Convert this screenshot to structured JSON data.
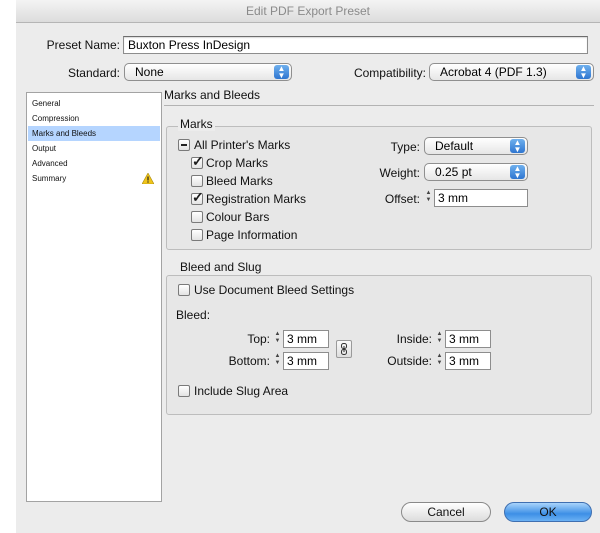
{
  "window": {
    "title": "Edit PDF Export Preset"
  },
  "preset": {
    "label": "Preset Name:",
    "value": "Buxton Press InDesign"
  },
  "standard": {
    "label": "Standard:",
    "value": "None"
  },
  "compatibility": {
    "label": "Compatibility:",
    "value": "Acrobat 4 (PDF 1.3)"
  },
  "sidebar": {
    "items": [
      {
        "label": "General"
      },
      {
        "label": "Compression"
      },
      {
        "label": "Marks and Bleeds"
      },
      {
        "label": "Output"
      },
      {
        "label": "Advanced"
      },
      {
        "label": "Summary"
      }
    ],
    "selected": "Marks and Bleeds",
    "warning_icon": "warning-icon"
  },
  "panel": {
    "title": "Marks and Bleeds"
  },
  "marks": {
    "group_title": "Marks",
    "all": {
      "label": "All Printer's Marks",
      "state": "mixed"
    },
    "crop": {
      "label": "Crop Marks",
      "checked": true
    },
    "bleed": {
      "label": "Bleed Marks",
      "checked": false
    },
    "registration": {
      "label": "Registration Marks",
      "checked": true
    },
    "colour_bars": {
      "label": "Colour Bars",
      "checked": false
    },
    "page_info": {
      "label": "Page Information",
      "checked": false
    },
    "type": {
      "label": "Type:",
      "value": "Default"
    },
    "weight": {
      "label": "Weight:",
      "value": "0.25 pt"
    },
    "offset": {
      "label": "Offset:",
      "value": "3 mm"
    }
  },
  "bleed_slug": {
    "group_title": "Bleed and Slug",
    "use_document": {
      "label": "Use Document Bleed Settings",
      "checked": false
    },
    "bleed_label": "Bleed:",
    "top": {
      "label": "Top:",
      "value": "3 mm"
    },
    "bottom": {
      "label": "Bottom:",
      "value": "3 mm"
    },
    "inside": {
      "label": "Inside:",
      "value": "3 mm"
    },
    "outside": {
      "label": "Outside:",
      "value": "3 mm"
    },
    "include_slug": {
      "label": "Include Slug Area",
      "checked": false
    }
  },
  "buttons": {
    "cancel": "Cancel",
    "ok": "OK"
  },
  "colors": {
    "selection": "#b5d5ff",
    "aqua_blue": "#3d8fe6",
    "warning": "#f0c419"
  }
}
